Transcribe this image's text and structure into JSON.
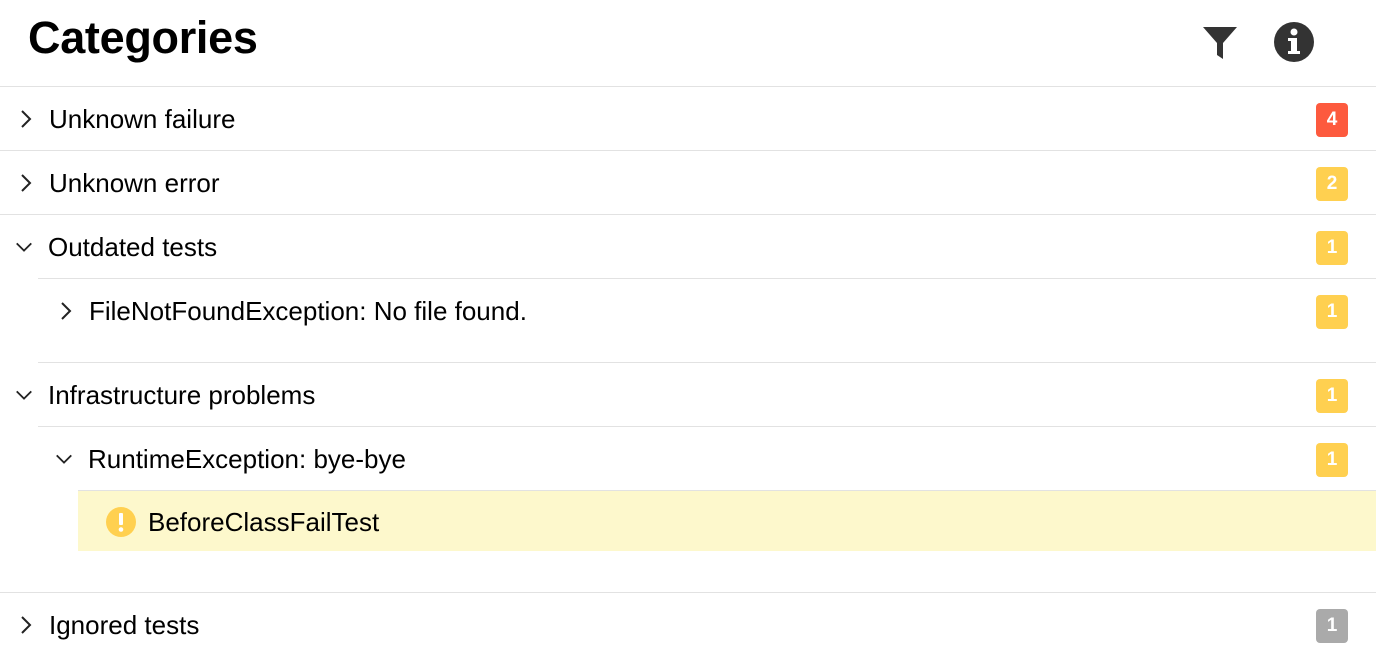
{
  "header": {
    "title": "Categories",
    "filter_icon": "filter-icon",
    "info_icon": "info-icon"
  },
  "colors": {
    "failed": "#fd5a3e",
    "broken": "#ffd050",
    "skipped": "#aaaaaa",
    "selected_row": "#fdf8cc"
  },
  "categories": [
    {
      "label": "Unknown failure",
      "count": "4",
      "expanded": false,
      "status": "failed"
    },
    {
      "label": "Unknown error",
      "count": "2",
      "expanded": false,
      "status": "broken"
    },
    {
      "label": "Outdated tests",
      "count": "1",
      "expanded": true,
      "status": "broken",
      "children": [
        {
          "label": "FileNotFoundException: No file found.",
          "count": "1",
          "expanded": false,
          "status": "broken"
        }
      ]
    },
    {
      "label": "Infrastructure problems",
      "count": "1",
      "expanded": true,
      "status": "broken",
      "children": [
        {
          "label": "RuntimeException: bye-bye",
          "count": "1",
          "expanded": true,
          "status": "broken",
          "tests": [
            {
              "label": "BeforeClassFailTest",
              "status": "broken"
            }
          ]
        }
      ]
    },
    {
      "label": "Ignored tests",
      "count": "1",
      "expanded": false,
      "status": "skipped"
    }
  ]
}
